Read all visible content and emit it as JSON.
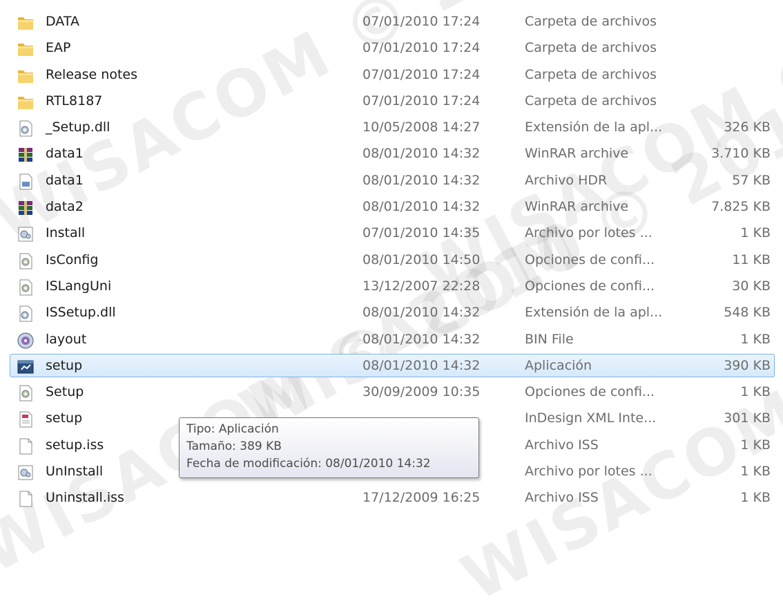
{
  "files": [
    {
      "name": "DATA",
      "date": "07/01/2010 17:24",
      "type": "Carpeta de archivos",
      "size": "",
      "icon": "folder-icon"
    },
    {
      "name": "EAP",
      "date": "07/01/2010 17:24",
      "type": "Carpeta de archivos",
      "size": "",
      "icon": "folder-icon"
    },
    {
      "name": "Release notes",
      "date": "07/01/2010 17:24",
      "type": "Carpeta de archivos",
      "size": "",
      "icon": "folder-icon"
    },
    {
      "name": "RTL8187",
      "date": "07/01/2010 17:24",
      "type": "Carpeta de archivos",
      "size": "",
      "icon": "folder-icon"
    },
    {
      "name": "_Setup.dll",
      "date": "10/05/2008 14:27",
      "type": "Extensión de la apl...",
      "size": "326 KB",
      "icon": "dll-icon"
    },
    {
      "name": "data1",
      "date": "08/01/2010 14:32",
      "type": "WinRAR archive",
      "size": "3.710 KB",
      "icon": "winrar-icon"
    },
    {
      "name": "data1",
      "date": "08/01/2010 14:32",
      "type": "Archivo HDR",
      "size": "57 KB",
      "icon": "hdr-file-icon"
    },
    {
      "name": "data2",
      "date": "08/01/2010 14:32",
      "type": "WinRAR archive",
      "size": "7.825 KB",
      "icon": "winrar-icon"
    },
    {
      "name": "Install",
      "date": "07/01/2010 14:35",
      "type": "Archivo por lotes ...",
      "size": "1 KB",
      "icon": "batch-file-icon"
    },
    {
      "name": "IsConfig",
      "date": "08/01/2010 14:50",
      "type": "Opciones de confi...",
      "size": "11 KB",
      "icon": "config-file-icon"
    },
    {
      "name": "ISLangUni",
      "date": "13/12/2007 22:28",
      "type": "Opciones de confi...",
      "size": "30 KB",
      "icon": "config-file-icon"
    },
    {
      "name": "ISSetup.dll",
      "date": "08/01/2010 14:32",
      "type": "Extensión de la apl...",
      "size": "548 KB",
      "icon": "dll-icon"
    },
    {
      "name": "layout",
      "date": "08/01/2010 14:32",
      "type": "BIN File",
      "size": "1 KB",
      "icon": "disc-icon"
    },
    {
      "name": "setup",
      "date": "08/01/2010 14:32",
      "type": "Aplicación",
      "size": "390 KB",
      "icon": "application-icon",
      "selected": true
    },
    {
      "name": "Setup",
      "date": "30/09/2009 10:35",
      "type": "Opciones de confi...",
      "size": "1 KB",
      "icon": "config-file-icon"
    },
    {
      "name": "setup",
      "date": "",
      "type": "InDesign XML Inte...",
      "size": "301 KB",
      "icon": "xml-file-icon"
    },
    {
      "name": "setup.iss",
      "date": "",
      "type": "Archivo ISS",
      "size": "1 KB",
      "icon": "blank-file-icon"
    },
    {
      "name": "UnInstall",
      "date": "07/01/2010 14:35",
      "type": "Archivo por lotes ...",
      "size": "1 KB",
      "icon": "batch-file-icon"
    },
    {
      "name": "Uninstall.iss",
      "date": "17/12/2009 16:25",
      "type": "Archivo ISS",
      "size": "1 KB",
      "icon": "blank-file-icon"
    }
  ],
  "tooltip": {
    "type_line": "Tipo: Aplicación",
    "size_line": "Tamaño: 389 KB",
    "modified_line": "Fecha de modificación: 08/01/2010 14:32"
  },
  "watermark": "WISACOM © 2010",
  "colors": {
    "selection_border": "#7fb4e6",
    "selection_fill": "#dcecfc",
    "secondary_text": "#6d6d6d"
  }
}
